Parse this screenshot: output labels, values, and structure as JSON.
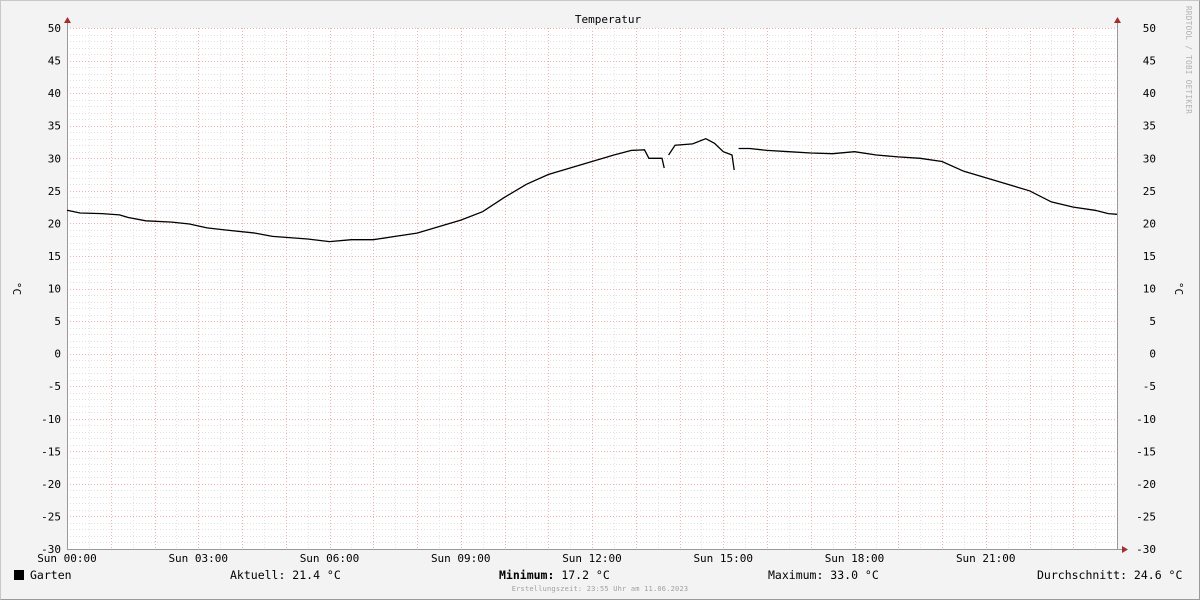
{
  "chart_data": {
    "type": "line",
    "title": "Temperatur",
    "ylabel": "°C",
    "ylim": [
      -30,
      50
    ],
    "yticks": [
      50,
      45,
      40,
      35,
      30,
      25,
      20,
      15,
      10,
      5,
      0,
      -5,
      -10,
      -15,
      -20,
      -25,
      -30
    ],
    "xlim": [
      0,
      24
    ],
    "xticks": [
      {
        "x": 0,
        "label": "Sun 00:00"
      },
      {
        "x": 3,
        "label": "Sun 03:00"
      },
      {
        "x": 6,
        "label": "Sun 06:00"
      },
      {
        "x": 9,
        "label": "Sun 09:00"
      },
      {
        "x": 12,
        "label": "Sun 12:00"
      },
      {
        "x": 15,
        "label": "Sun 15:00"
      },
      {
        "x": 18,
        "label": "Sun 18:00"
      },
      {
        "x": 21,
        "label": "Sun 21:00"
      }
    ],
    "grid": true,
    "series": [
      {
        "name": "Garten",
        "color": "#000000",
        "segments": [
          [
            [
              0.0,
              22.0
            ],
            [
              0.3,
              21.6
            ],
            [
              0.8,
              21.5
            ],
            [
              1.2,
              21.3
            ],
            [
              1.4,
              20.9
            ],
            [
              1.8,
              20.4
            ],
            [
              2.4,
              20.2
            ],
            [
              2.8,
              19.9
            ],
            [
              3.2,
              19.3
            ],
            [
              3.6,
              19.0
            ],
            [
              4.3,
              18.5
            ],
            [
              4.7,
              18.0
            ],
            [
              5.5,
              17.6
            ],
            [
              6.0,
              17.2
            ],
            [
              6.5,
              17.5
            ],
            [
              7.0,
              17.5
            ],
            [
              7.5,
              18.0
            ],
            [
              8.0,
              18.5
            ],
            [
              8.5,
              19.5
            ],
            [
              9.0,
              20.5
            ],
            [
              9.5,
              21.8
            ],
            [
              10.0,
              24.0
            ],
            [
              10.5,
              26.0
            ],
            [
              11.0,
              27.5
            ],
            [
              11.5,
              28.5
            ],
            [
              12.0,
              29.5
            ],
            [
              12.5,
              30.5
            ],
            [
              12.9,
              31.2
            ],
            [
              13.2,
              31.3
            ],
            [
              13.3,
              30.0
            ],
            [
              13.6,
              30.0
            ],
            [
              13.65,
              28.5
            ]
          ],
          [
            [
              13.75,
              30.5
            ],
            [
              13.9,
              32.0
            ],
            [
              14.3,
              32.2
            ],
            [
              14.6,
              33.0
            ],
            [
              14.8,
              32.3
            ],
            [
              15.0,
              31.0
            ],
            [
              15.2,
              30.5
            ],
            [
              15.25,
              28.2
            ]
          ],
          [
            [
              15.35,
              31.5
            ],
            [
              15.6,
              31.5
            ],
            [
              16.0,
              31.2
            ],
            [
              16.5,
              31.0
            ],
            [
              17.0,
              30.8
            ],
            [
              17.5,
              30.7
            ],
            [
              18.0,
              31.0
            ],
            [
              18.5,
              30.5
            ],
            [
              19.0,
              30.2
            ],
            [
              19.5,
              30.0
            ],
            [
              20.0,
              29.5
            ],
            [
              20.5,
              28.0
            ],
            [
              21.0,
              27.0
            ],
            [
              21.5,
              26.0
            ],
            [
              22.0,
              25.0
            ],
            [
              22.5,
              23.3
            ],
            [
              23.0,
              22.5
            ],
            [
              23.5,
              22.0
            ],
            [
              23.8,
              21.5
            ],
            [
              24.0,
              21.4
            ]
          ]
        ]
      }
    ],
    "legend": [
      {
        "label": "Garten",
        "color": "#000000"
      }
    ]
  },
  "legend_row": {
    "aktuell": "Aktuell: 21.4 °C",
    "minimum_label": "Minimum:",
    "minimum_value": " 17.2 °C",
    "maximum": "Maximum: 33.0 °C",
    "durchschnitt": "Durchschnitt: 24.6 °C"
  },
  "footer": "Erstellungszeit: 23:55 Uhr am 11.06.2023",
  "watermark": "RRDTOOL / TOBI OETIKER"
}
